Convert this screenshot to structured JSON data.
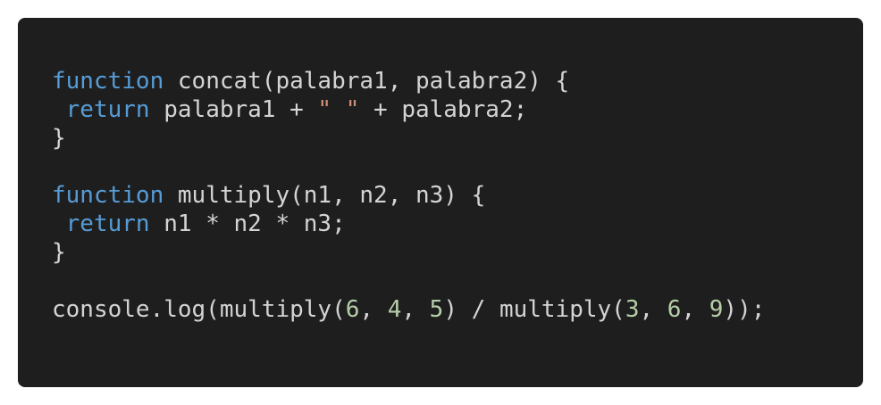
{
  "colors": {
    "background": "#1e1e1e",
    "keyword": "#569cd6",
    "text": "#d4d4d4",
    "string": "#ce9178",
    "number": "#b5cea8"
  },
  "code": {
    "lines": [
      [
        {
          "type": "keyword",
          "text": "function"
        },
        {
          "type": "ident",
          "text": " concat(palabra1, palabra2) {"
        }
      ],
      [
        {
          "type": "ident",
          "text": " "
        },
        {
          "type": "keyword",
          "text": "return"
        },
        {
          "type": "ident",
          "text": " palabra1 + "
        },
        {
          "type": "string",
          "text": "\" \""
        },
        {
          "type": "ident",
          "text": " + palabra2;"
        }
      ],
      [
        {
          "type": "ident",
          "text": "}"
        }
      ],
      [],
      [
        {
          "type": "keyword",
          "text": "function"
        },
        {
          "type": "ident",
          "text": " multiply(n1, n2, n3) {"
        }
      ],
      [
        {
          "type": "ident",
          "text": " "
        },
        {
          "type": "keyword",
          "text": "return"
        },
        {
          "type": "ident",
          "text": " n1 * n2 * n3;"
        }
      ],
      [
        {
          "type": "ident",
          "text": "}"
        }
      ],
      [],
      [
        {
          "type": "ident",
          "text": "console.log(multiply("
        },
        {
          "type": "number",
          "text": "6"
        },
        {
          "type": "ident",
          "text": ", "
        },
        {
          "type": "number",
          "text": "4"
        },
        {
          "type": "ident",
          "text": ", "
        },
        {
          "type": "number",
          "text": "5"
        },
        {
          "type": "ident",
          "text": ") / multiply("
        },
        {
          "type": "number",
          "text": "3"
        },
        {
          "type": "ident",
          "text": ", "
        },
        {
          "type": "number",
          "text": "6"
        },
        {
          "type": "ident",
          "text": ", "
        },
        {
          "type": "number",
          "text": "9"
        },
        {
          "type": "ident",
          "text": "));"
        }
      ]
    ]
  }
}
